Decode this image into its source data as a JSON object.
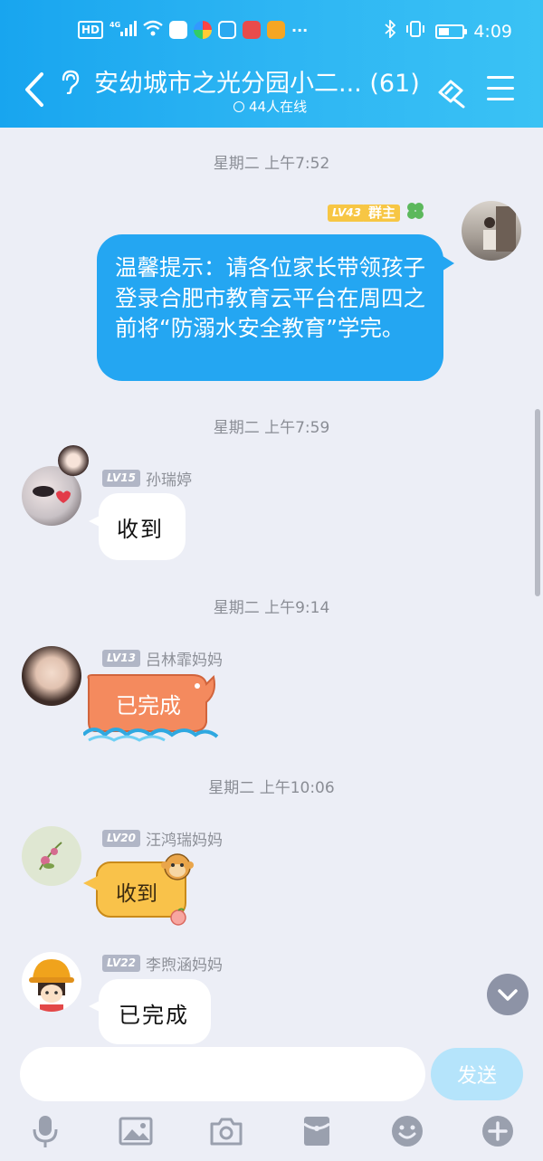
{
  "status_bar": {
    "time": "4:09",
    "hd": "HD",
    "network": "4G"
  },
  "header": {
    "title": "安幼城市之光分园小二... (61)",
    "online": "44人在线"
  },
  "messages": [
    {
      "timestamp": "星期二 上午7:52",
      "sender_level": "LV43",
      "sender_role": "群主",
      "text": "温馨提示：请各位家长带领孩子登录合肥市教育云平台在周四之前将“防溺水安全教育”学完。"
    },
    {
      "timestamp": "星期二 上午7:59",
      "sender_level": "LV15",
      "sender_name": "孙瑞婷",
      "text": "收到"
    },
    {
      "timestamp": "星期二 上午9:14",
      "sender_level": "LV13",
      "sender_name": "吕林霏妈妈",
      "text": "已完成"
    },
    {
      "timestamp": "星期二 上午10:06",
      "sender_level": "LV20",
      "sender_name": "汪鸿瑞妈妈",
      "text": "收到"
    },
    {
      "sender_level": "LV22",
      "sender_name": "李煦涵妈妈",
      "text": "已完成"
    }
  ],
  "input": {
    "placeholder": "",
    "send_label": "发送"
  },
  "colors": {
    "header": "#18a5ef",
    "own_bubble": "#24a6f2",
    "background": "#eceef6"
  }
}
